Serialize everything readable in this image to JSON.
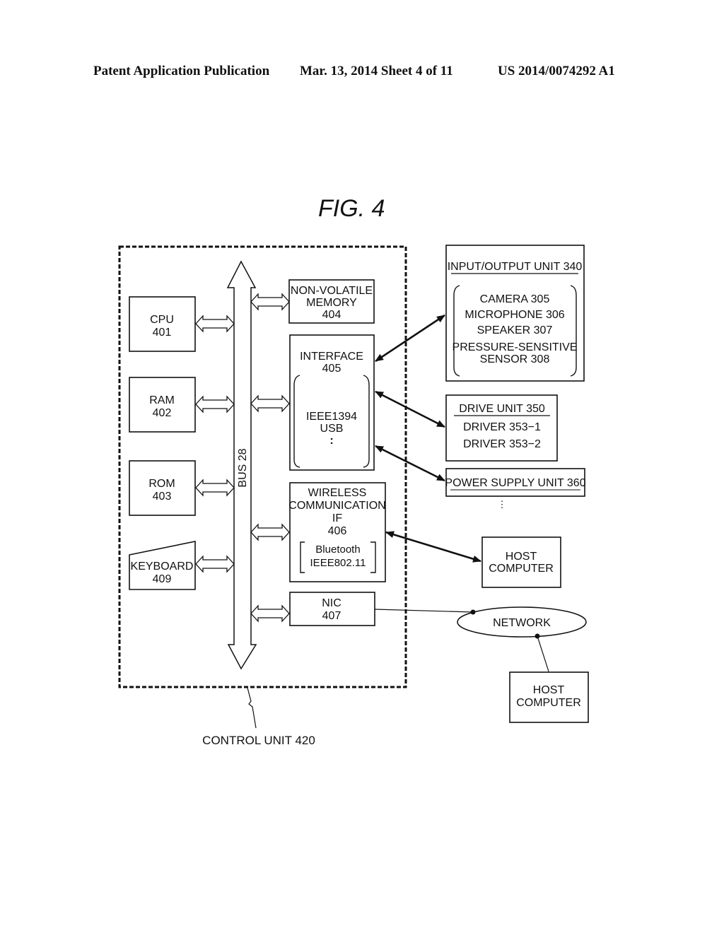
{
  "header": {
    "publication": "Patent Application Publication",
    "date_sheet": "Mar. 13, 2014  Sheet 4 of 11",
    "number": "US 2014/0074292 A1"
  },
  "figure": {
    "title": "FIG. 4"
  },
  "control_unit": {
    "label": "CONTROL UNIT 420",
    "bus": "BUS 28",
    "left_blocks": [
      {
        "name": "CPU",
        "ref": "401"
      },
      {
        "name": "RAM",
        "ref": "402"
      },
      {
        "name": "ROM",
        "ref": "403"
      },
      {
        "name": "KEYBOARD",
        "ref": "409"
      }
    ],
    "nonvolatile": {
      "line1": "NON-VOLATILE",
      "line2": "MEMORY",
      "ref": "404"
    },
    "interface": {
      "name": "INTERFACE",
      "ref": "405",
      "items": [
        "IEEE1394",
        "USB",
        ":"
      ]
    },
    "wireless": {
      "line1": "WIRELESS",
      "line2": "COMMUNICATION",
      "line3": "IF",
      "ref": "406",
      "items": [
        "Bluetooth",
        "IEEE802.11"
      ]
    },
    "nic": {
      "name": "NIC",
      "ref": "407"
    }
  },
  "io_unit": {
    "title": "INPUT/OUTPUT UNIT 340",
    "items": [
      "CAMERA 305",
      "MICROPHONE 306",
      "SPEAKER 307",
      "PRESSURE-SENSITIVE",
      "SENSOR 308"
    ]
  },
  "drive_unit": {
    "title": "DRIVE UNIT 350",
    "items": [
      "DRIVER 353−1",
      "DRIVER 353−2"
    ]
  },
  "power_supply": {
    "title": "POWER SUPPLY UNIT 360",
    "ellipsis": "⋮"
  },
  "host1": {
    "line1": "HOST",
    "line2": "COMPUTER"
  },
  "network": {
    "label": "NETWORK"
  },
  "host2": {
    "line1": "HOST",
    "line2": "COMPUTER"
  }
}
